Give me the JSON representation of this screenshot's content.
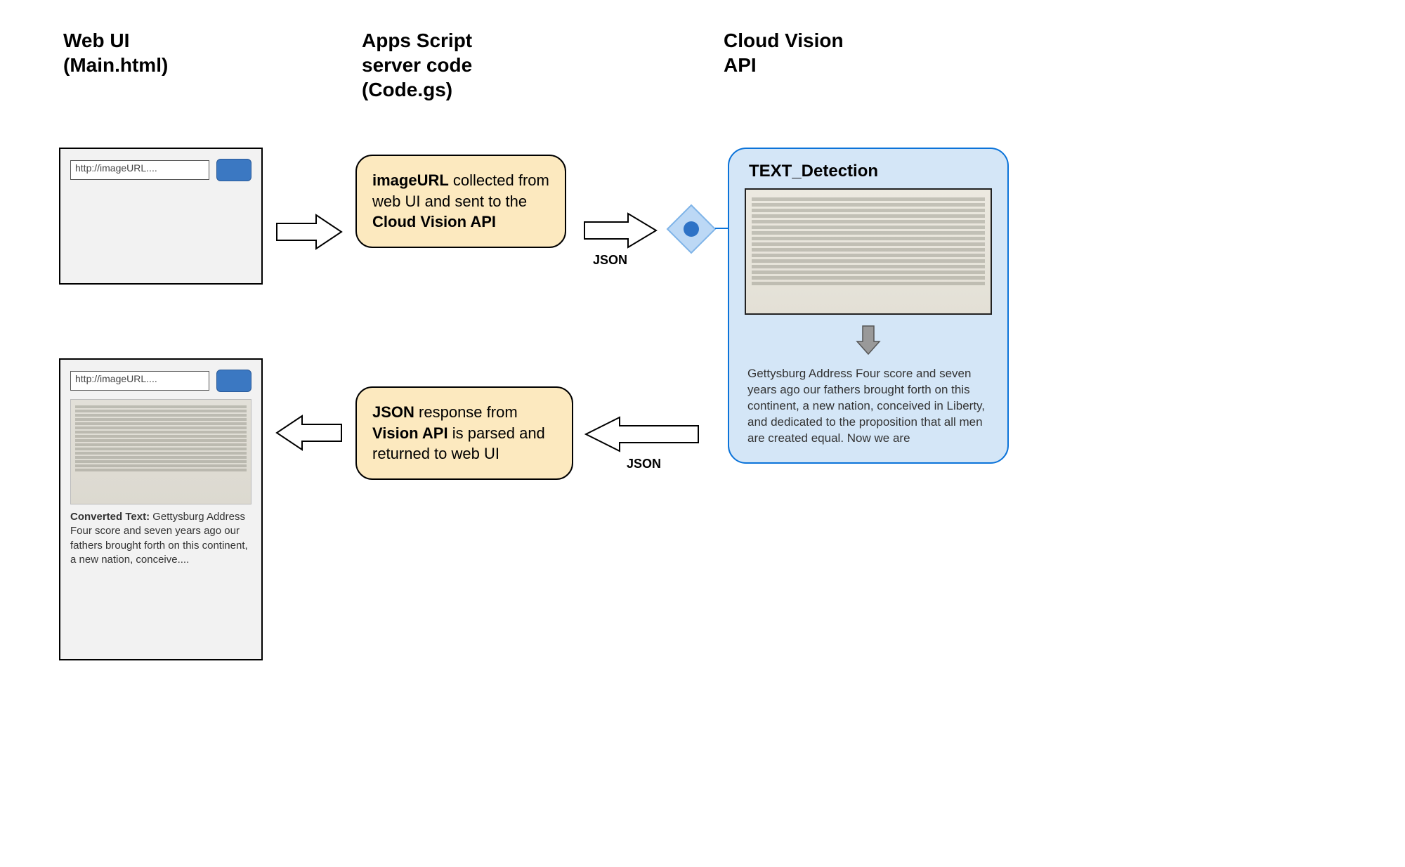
{
  "headers": {
    "webui": "Web UI\n(Main.html)",
    "apps_script": "Apps Script\nserver code\n(Code.gs)",
    "vision": "Cloud Vision\nAPI"
  },
  "webui_top": {
    "url": "http://imageURL...."
  },
  "webui_bottom": {
    "url": "http://imageURL....",
    "converted_label": "Converted Text:",
    "converted_body": " Gettysburg Address Four score and seven years ago our fathers brought forth on this continent, a new nation, conceive...."
  },
  "apps_box_top": "<b>imageURL</b> collected from web UI and sent to the <br><b>Cloud Vision API</b>",
  "apps_box_bottom": "<b>JSON</b> response from <b>Vision API</b> is parsed and returned to web UI",
  "arrows": {
    "right1": "",
    "right2_label": "JSON",
    "left1_label": "JSON",
    "left2": ""
  },
  "vision_panel": {
    "title": "TEXT_Detection",
    "extracted": "Gettysburg Address Four score and seven years ago our fathers brought forth on this continent, a new nation, conceived in Liberty, and dedicated to the proposition that all men are created equal. Now we are"
  }
}
